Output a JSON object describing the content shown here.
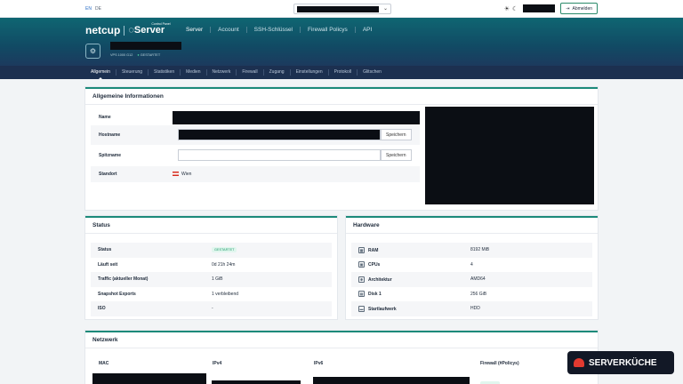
{
  "topbar": {
    "lang_en": "EN",
    "lang_de": "DE",
    "theme_icons": [
      "sun-icon",
      "moon-icon"
    ],
    "logout_label": "Abmelden"
  },
  "header": {
    "logo_text": "netcup",
    "cp_subtitle": "Control Panel",
    "cp_title": "Server",
    "nav": [
      "Server",
      "Account",
      "SSH-Schlüssel",
      "Firewall Policys",
      "API"
    ],
    "server_model": "VPS 1000 G12",
    "server_state": "GESTARTET"
  },
  "subnav": [
    "Allgemein",
    "Steuerung",
    "Statistiken",
    "Medien",
    "Netzwerk",
    "Firewall",
    "Zugang",
    "Einstellungen",
    "Protokoll",
    "Glitschen"
  ],
  "general": {
    "title": "Allgemeine Informationen",
    "name_label": "Name",
    "hostname_label": "Hostname",
    "nickname_label": "Spitzname",
    "location_label": "Standort",
    "location_value": "Wien",
    "save_label": "Speichern"
  },
  "status": {
    "title": "Status",
    "rows": [
      {
        "label": "Status",
        "value": "GESTARTET"
      },
      {
        "label": "Läuft seit",
        "value": "0d 21h 24m"
      },
      {
        "label": "Traffic (aktueller Monat)",
        "value": "1 GiB"
      },
      {
        "label": "Snapshot Exports",
        "value": "1 verbleibend"
      },
      {
        "label": "ISO",
        "value": "-"
      }
    ]
  },
  "hardware": {
    "title": "Hardware",
    "rows": [
      {
        "label": "RAM",
        "value": "8192 MiB",
        "icon": "memory-icon"
      },
      {
        "label": "CPUs",
        "value": "4",
        "icon": "cpu-icon"
      },
      {
        "label": "Architektur",
        "value": "AMD64",
        "icon": "chip-icon"
      },
      {
        "label": "Disk 1",
        "value": "256 GiB",
        "icon": "disk-icon"
      },
      {
        "label": "Startlaufwerk",
        "value": "HDD",
        "icon": "drive-icon"
      }
    ]
  },
  "network": {
    "title": "Netzwerk",
    "columns": [
      "MAC",
      "IPv4",
      "IPv6",
      "Firewall (#Policys)"
    ]
  },
  "watermark": "SERVERKÜCHE"
}
